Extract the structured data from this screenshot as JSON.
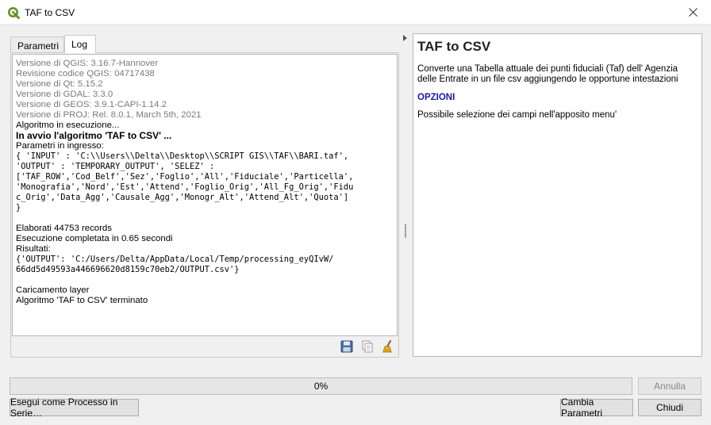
{
  "window": {
    "title": "TAF to CSV",
    "icon": "qgis-logo-icon",
    "close_icon": "close-icon"
  },
  "tabs": [
    {
      "label": "Parametri",
      "active": false
    },
    {
      "label": "Log",
      "active": true
    }
  ],
  "log": {
    "lines": [
      {
        "text": "Versione di QGIS: 3.16.7-Hannover",
        "style": "gray"
      },
      {
        "text": "Revisione codice QGIS: 04717438",
        "style": "gray"
      },
      {
        "text": "Versione di Qt: 5.15.2",
        "style": "gray"
      },
      {
        "text": "Versione di GDAL: 3.3.0",
        "style": "gray"
      },
      {
        "text": "Versione di GEOS: 3.9.1-CAPI-1.14.2",
        "style": "gray"
      },
      {
        "text": "Versione di PROJ: Rel. 8.0.1, March 5th, 2021",
        "style": "gray"
      },
      {
        "text": "Algoritmo in esecuzione...",
        "style": "normal"
      },
      {
        "text": "In avvio l'algoritmo 'TAF to CSV' ...",
        "style": "bold"
      },
      {
        "text": "Parametri in ingresso:",
        "style": "normal"
      },
      {
        "text": "{ 'INPUT' : 'C:\\\\Users\\\\Delta\\\\Desktop\\\\SCRIPT GIS\\\\TAF\\\\BARI.taf',",
        "style": "mono"
      },
      {
        "text": "'OUTPUT' : 'TEMPORARY_OUTPUT', 'SELEZ' :",
        "style": "mono"
      },
      {
        "text": "['TAF_ROW','Cod_Belf','Sez','Foglio','All','Fiduciale','Particella',",
        "style": "mono"
      },
      {
        "text": "'Monografia','Nord','Est','Attend','Foglio_Orig','All_Fg_Orig','Fidu",
        "style": "mono"
      },
      {
        "text": "c_Orig','Data_Agg','Causale_Agg','Monogr_Alt','Attend_Alt','Quota']",
        "style": "mono"
      },
      {
        "text": "}",
        "style": "mono"
      },
      {
        "text": "",
        "style": "blank"
      },
      {
        "text": "Elaborati 44753 records",
        "style": "normal"
      },
      {
        "text": "Esecuzione completata in 0.65 secondi",
        "style": "normal"
      },
      {
        "text": "Risultati:",
        "style": "normal"
      },
      {
        "text": "{'OUTPUT': 'C:/Users/Delta/AppData/Local/Temp/processing_eyQIvW/",
        "style": "mono"
      },
      {
        "text": "66dd5d49593a446696620d8159c70eb2/OUTPUT.csv'}",
        "style": "mono"
      },
      {
        "text": "",
        "style": "blank"
      },
      {
        "text": "Caricamento layer",
        "style": "normal"
      },
      {
        "text": "Algoritmo 'TAF to CSV' terminato",
        "style": "normal"
      }
    ],
    "tools": [
      "save-log-icon",
      "copy-log-icon",
      "clear-log-icon"
    ]
  },
  "help": {
    "title": "TAF to CSV",
    "description": "Converte una Tabella attuale dei punti fiduciali (Taf) dell' Agenzia delle Entrate in un file csv aggiungendo le opportune intestazioni",
    "section": "OPZIONI",
    "note": "Possibile selezione dei campi nell'apposito menu'"
  },
  "progress": {
    "text": "0%",
    "value": 0
  },
  "buttons": {
    "batch": "Esegui come Processo in Serie…",
    "cancel": "Annulla",
    "change": "Cambia Parametri",
    "close": "Chiudi"
  },
  "colors": {
    "accent_link": "#1a1aaa",
    "qgis_green": "#589632",
    "qgis_yellow": "#ee7913"
  }
}
